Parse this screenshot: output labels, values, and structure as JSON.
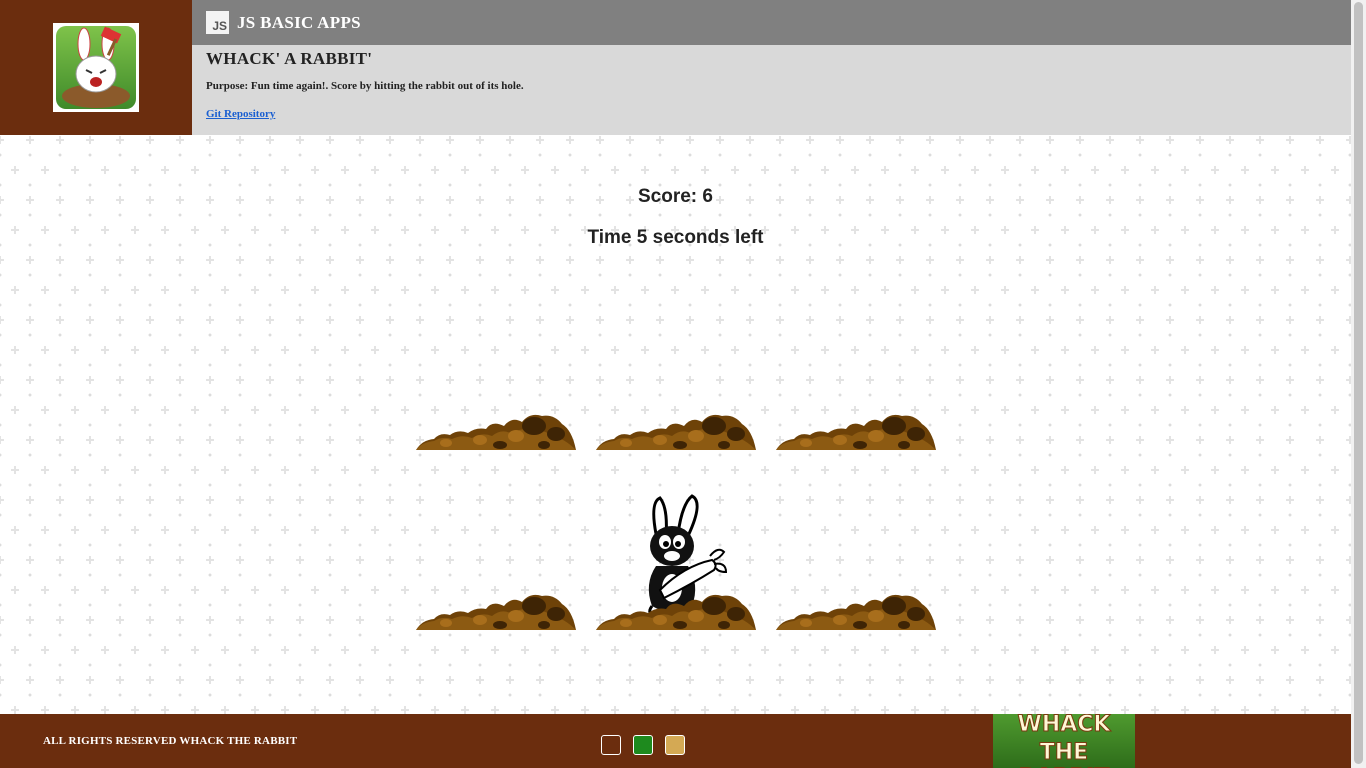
{
  "header": {
    "badge_label": "JS",
    "app_title": "JS BASIC APPS",
    "page_title": "WHACK' A RABBIT'",
    "purpose": "Purpose: Fun time again!. Score by hitting the rabbit out of its hole.",
    "git_link": "Git Repository"
  },
  "game": {
    "score_text": "Score: 6",
    "timer_text": "Time 5 seconds left",
    "holes": [
      {
        "has_rabbit": false
      },
      {
        "has_rabbit": false
      },
      {
        "has_rabbit": false
      },
      {
        "has_rabbit": false
      },
      {
        "has_rabbit": true
      },
      {
        "has_rabbit": false
      }
    ]
  },
  "footer": {
    "rights_text": "ALL RIGHTS RESERVED WHACK THE RABBIT",
    "brand_line1": "WHACK",
    "brand_line2": "THE RABBIT",
    "themes": [
      {
        "name": "theme-brown",
        "color": "#6b2d0e"
      },
      {
        "name": "theme-green",
        "color": "#1e8a1e"
      },
      {
        "name": "theme-tan",
        "color": "#d4a954"
      }
    ]
  },
  "colors": {
    "header_brown": "#6b2d0e",
    "topbar_gray": "#808080",
    "infobar_gray": "#d9d9d9",
    "link_blue": "#1a5fd1"
  }
}
